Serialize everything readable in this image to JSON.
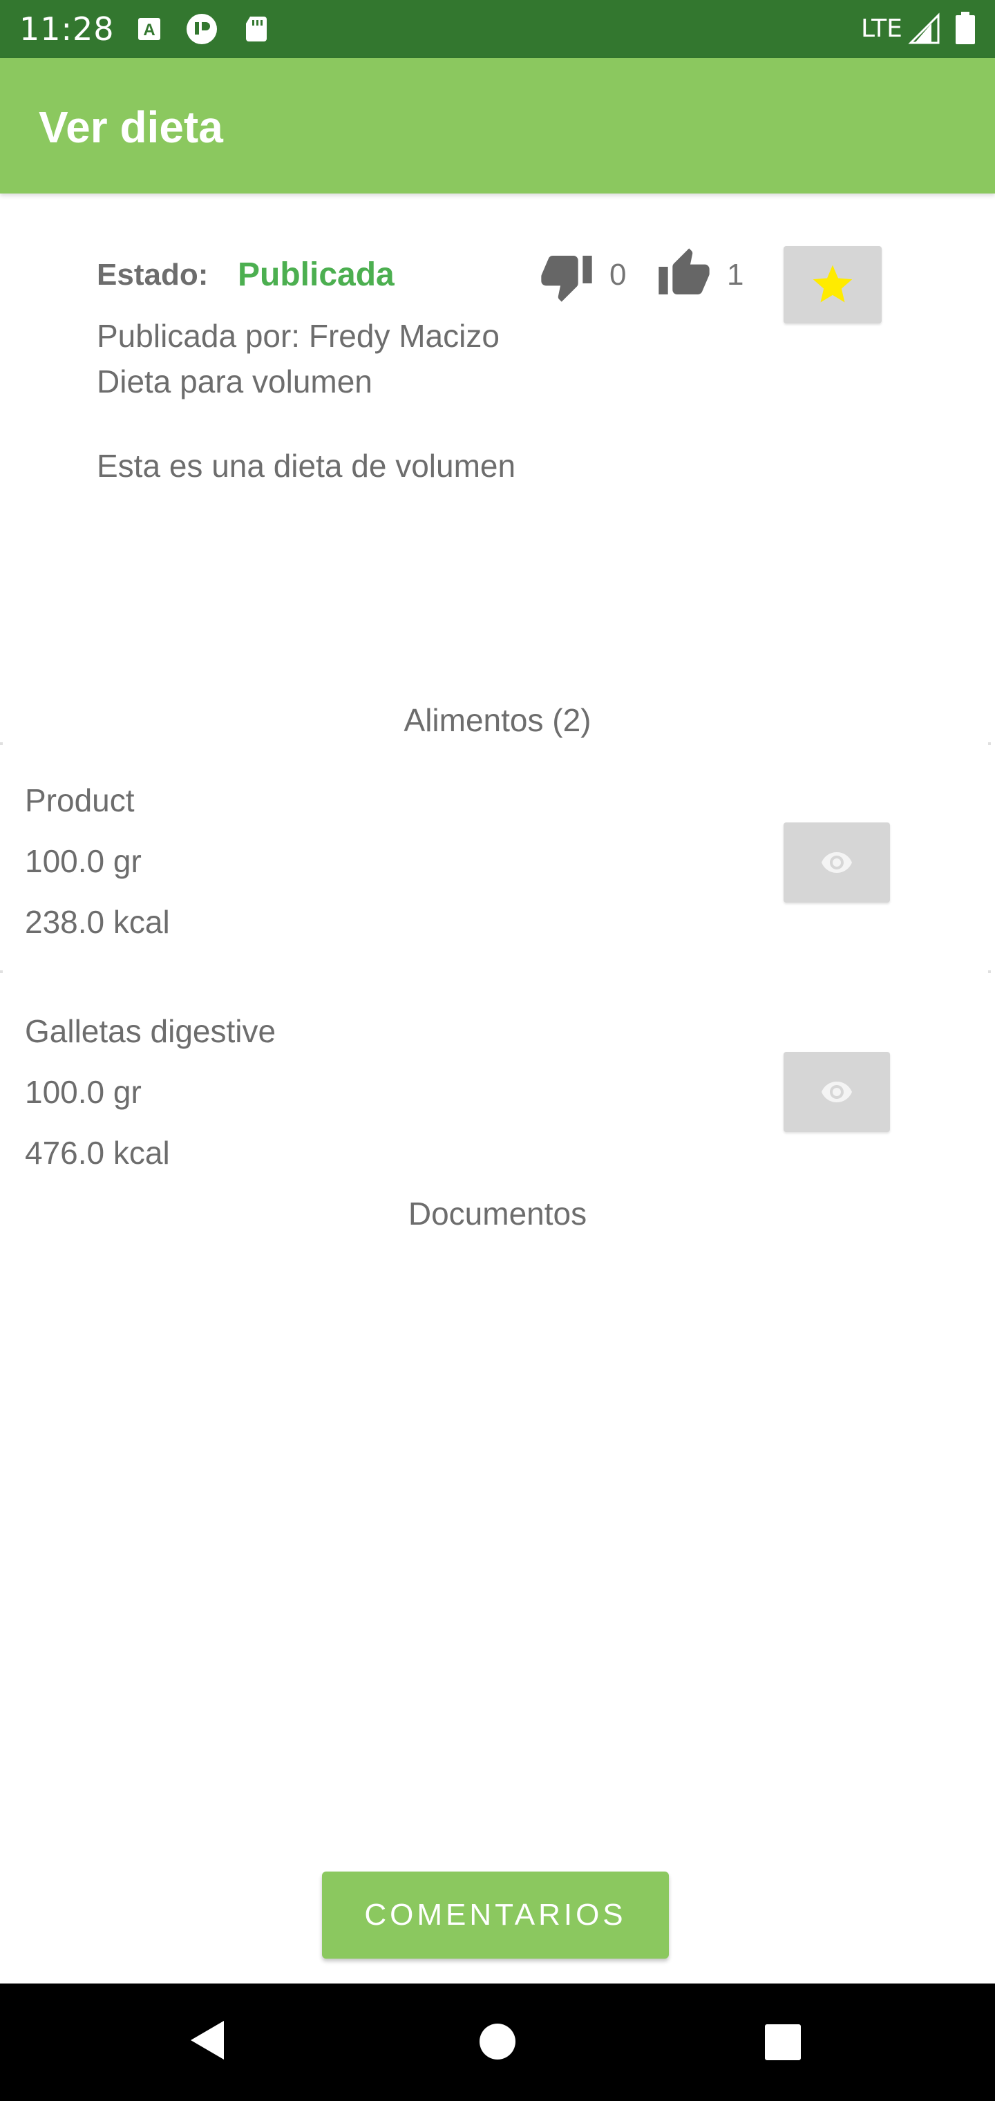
{
  "status_bar": {
    "time": "11:28",
    "network": "LTE",
    "icons": [
      "text-a-icon",
      "notification-icon",
      "sd-card-icon",
      "signal-icon",
      "battery-icon"
    ]
  },
  "app_bar": {
    "title": "Ver dieta"
  },
  "diet": {
    "estado_label": "Estado:",
    "estado_value": "Publicada",
    "dislikes": "0",
    "likes": "1",
    "published_by": "Publicada por: Fredy Macizo",
    "name": "Dieta para volumen",
    "description": "Esta es una dieta de volumen"
  },
  "alimentos": {
    "title": "Alimentos (2)",
    "items": [
      {
        "name": "Product",
        "quantity": "100.0 gr",
        "calories": "238.0 kcal"
      },
      {
        "name": "Galletas digestive",
        "quantity": "100.0 gr",
        "calories": "476.0 kcal"
      }
    ]
  },
  "documentos": {
    "title": "Documentos"
  },
  "comments_button": {
    "label": "COMENTARIOS"
  },
  "colors": {
    "status_bar": "#33772f",
    "app_bar": "#8bc85f",
    "estado_published": "#4caf50",
    "star": "#ffeb00",
    "button_gray": "#d6d6d6"
  }
}
